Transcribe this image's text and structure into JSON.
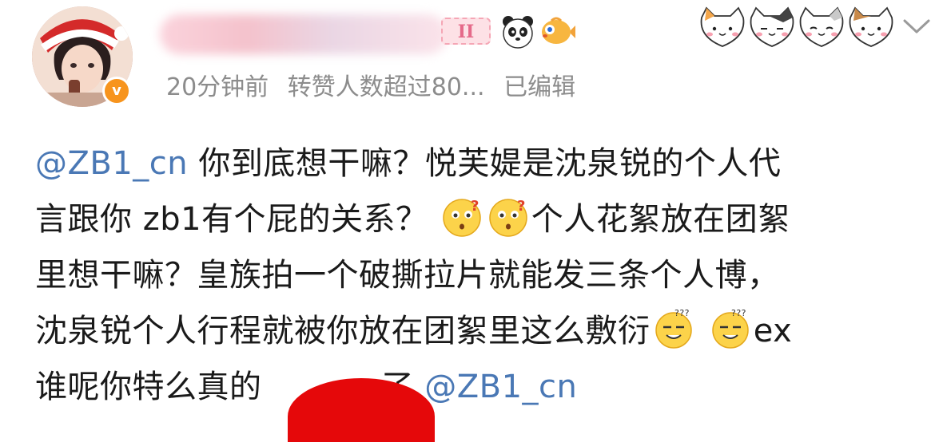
{
  "author": {
    "avatar_icon": "avatar-photo",
    "verified_icon": "verified-v-icon",
    "verified_mark": "v",
    "badges": [
      "membership-ii-badge",
      "panda-emoji",
      "fish-emoji"
    ],
    "badge_label": "II"
  },
  "meta": {
    "time": "20分钟前",
    "repost_info": "转赞人数超过80...",
    "edited": "已编辑"
  },
  "header_right": {
    "sticker": "cat-stickers",
    "menu_icon": "chevron-down-icon"
  },
  "post": {
    "line1_mention": "@ZB1_cn",
    "line1_text": " 你到底想干嘛？悦芙媞是沈泉锐的个人代",
    "line2_text": "言跟你 zb1有个屁的关系？",
    "line2_text_b": "个人花絮放在团絮",
    "line3_text": "里想干嘛？皇族拍一个破撕拉片就能发三条个人博，",
    "line4_text": "沈泉锐个人行程就被你放在团絮里这么敷衍",
    "line4_text_b": "ex",
    "line5_text": "谁呢你特么真的",
    "line5_text_b": "了 ",
    "line5_mention": "@ZB1_cn",
    "emojis": [
      "confused-emoji",
      "confused-emoji",
      "dizzy-emoji",
      "dizzy-emoji"
    ]
  },
  "colors": {
    "mention": "#4a78b5",
    "meta_text": "#8c8c8c",
    "redaction": "#e5080a",
    "verified": "#f7941d"
  }
}
